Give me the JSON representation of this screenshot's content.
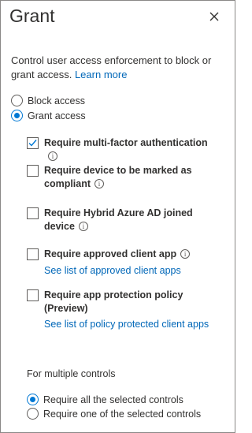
{
  "panel": {
    "title": "Grant",
    "close_icon": "close-icon"
  },
  "description": {
    "text": "Control user access enforcement to block or grant access.",
    "learn_more": "Learn more"
  },
  "access_options": [
    {
      "label": "Block access",
      "selected": false
    },
    {
      "label": "Grant access",
      "selected": true
    }
  ],
  "controls": [
    {
      "label": "Require multi-factor authentication",
      "checked": true
    },
    {
      "label": "Require device to be marked as compliant",
      "checked": false
    },
    {
      "label": "Require Hybrid Azure AD joined device",
      "checked": false
    },
    {
      "label": "Require approved client app",
      "checked": false,
      "link": "See list of approved client apps"
    },
    {
      "label": "Require app protection policy (Preview)",
      "checked": false,
      "link": "See list of policy protected client apps"
    }
  ],
  "multiple_controls": {
    "heading": "For multiple controls",
    "options": [
      {
        "label": "Require all the selected controls",
        "selected": true
      },
      {
        "label": "Require one of the selected controls",
        "selected": false
      }
    ]
  },
  "colors": {
    "accent": "#0078d4",
    "link": "#0067b8",
    "text": "#323130",
    "border": "#8a8886"
  }
}
